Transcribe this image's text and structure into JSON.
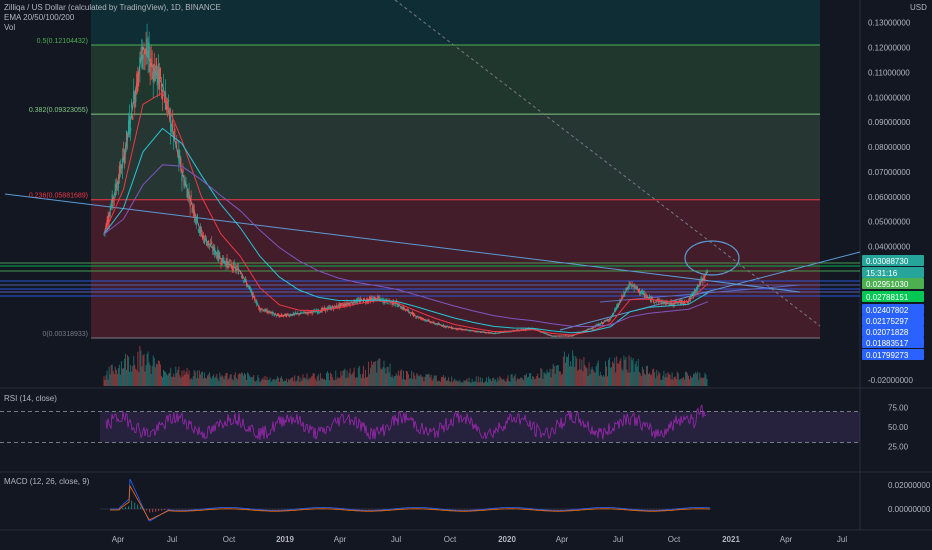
{
  "header": {
    "symbol_line": "Zilliqa / US Dollar (calculated by TradingView), 1D, BINANCE",
    "ema_label": "EMA 20/50/100/200",
    "vol_label": "Vol"
  },
  "price_axis": {
    "currency": "USD",
    "ticks": [
      "0.13000000",
      "0.12000000",
      "0.11000000",
      "0.10000000",
      "0.09000000",
      "0.08000000",
      "0.07000000",
      "0.06000000",
      "0.05000000",
      "0.04000000",
      "-0.02000000"
    ]
  },
  "price_badges": [
    {
      "text": "0.03088730",
      "color": "#26a69a"
    },
    {
      "text": "15:31:16",
      "color": "#26a69a"
    },
    {
      "text": "0.02951030",
      "color": "#4caf50"
    },
    {
      "text": "0.02788151",
      "color": "#00c853"
    },
    {
      "text": "0.02407802",
      "color": "#2962ff"
    },
    {
      "text": "0.02175297",
      "color": "#2962ff"
    },
    {
      "text": "0.02071828",
      "color": "#2962ff"
    },
    {
      "text": "0.01883517",
      "color": "#2962ff"
    },
    {
      "text": "0.01799273",
      "color": "#2962ff"
    }
  ],
  "fib_levels": [
    {
      "label": "0.5(0.12104432)",
      "price": 0.12104432,
      "color": "#4caf50"
    },
    {
      "label": "0.382(0.09323055)",
      "price": 0.09323055,
      "color": "#81c784"
    },
    {
      "label": "0.236(0.05881689)",
      "price": 0.05881689,
      "color": "#f23645"
    },
    {
      "label": "0(0.00318933)",
      "price": 0.00318933,
      "color": "#787b86"
    }
  ],
  "time_axis": [
    "Apr",
    "Jul",
    "Oct",
    "2019",
    "Apr",
    "Jul",
    "Oct",
    "2020",
    "Apr",
    "Jul",
    "Oct",
    "2021",
    "Apr",
    "Jul"
  ],
  "rsi": {
    "label": "RSI (14, close)",
    "ticks": [
      "75.00",
      "50.00",
      "25.00"
    ],
    "upper": 70,
    "lower": 30
  },
  "macd": {
    "label": "MACD (12, 26, close, 9)",
    "ticks": [
      "0.02000000",
      "0.00000000"
    ]
  },
  "chart_data": {
    "type": "line",
    "title": "Zilliqa / US Dollar (calculated by TradingView), 1D, BINANCE",
    "xlabel": "",
    "ylabel": "",
    "ylim": [
      -0.02,
      0.135
    ],
    "x": [
      "2018-04",
      "2018-05",
      "2018-06",
      "2018-07",
      "2018-08",
      "2018-09",
      "2018-10",
      "2018-11",
      "2018-12",
      "2019-01",
      "2019-02",
      "2019-03",
      "2019-04",
      "2019-05",
      "2019-06",
      "2019-07",
      "2019-08",
      "2019-09",
      "2019-10",
      "2019-11",
      "2019-12",
      "2020-01",
      "2020-02",
      "2020-03",
      "2020-04",
      "2020-05",
      "2020-06",
      "2020-07",
      "2020-08",
      "2020-09",
      "2020-10",
      "2020-11"
    ],
    "series": [
      {
        "values": [
          0.045,
          0.075,
          0.12,
          0.105,
          0.07,
          0.045,
          0.035,
          0.03,
          0.015,
          0.012,
          0.013,
          0.014,
          0.016,
          0.018,
          0.019,
          0.017,
          0.012,
          0.009,
          0.007,
          0.006,
          0.005,
          0.006,
          0.007,
          0.004,
          0.004,
          0.007,
          0.011,
          0.025,
          0.019,
          0.017,
          0.018,
          0.03
        ]
      }
    ],
    "volume": [
      0.3,
      0.7,
      0.9,
      0.5,
      0.4,
      0.35,
      0.3,
      0.3,
      0.25,
      0.2,
      0.25,
      0.3,
      0.35,
      0.4,
      0.6,
      0.45,
      0.3,
      0.25,
      0.2,
      0.2,
      0.2,
      0.25,
      0.3,
      0.5,
      0.9,
      0.5,
      0.6,
      0.7,
      0.4,
      0.3,
      0.3,
      0.35
    ]
  }
}
